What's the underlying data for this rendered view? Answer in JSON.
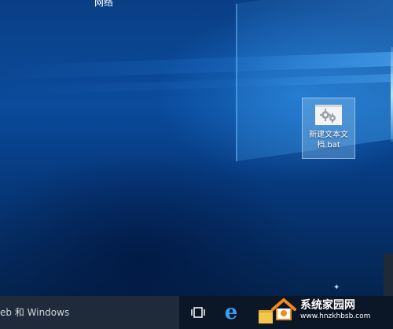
{
  "desktop": {
    "top_text": "网络",
    "icon": {
      "name": "gear-file-icon",
      "label": "新建文本文档.bat"
    }
  },
  "taskbar": {
    "search_text": "eb 和 Windows",
    "task_view_icon": "task-view-icon",
    "edge_icon": "edge-browser-icon",
    "explorer_icon": "file-explorer-icon"
  },
  "watermark": {
    "title": "系统家园网",
    "url": "www.hnzkhbsb.com"
  },
  "colors": {
    "desktop_blue": "#0a4b9c",
    "taskbar": "#0b1626",
    "edge_blue": "#3b9df0",
    "folder_yellow": "#f3c74c",
    "logo_orange": "#f08a1c"
  }
}
